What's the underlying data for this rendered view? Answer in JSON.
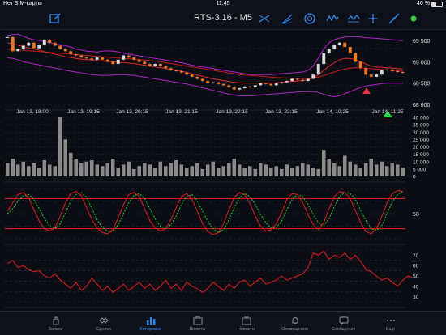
{
  "status_bar": {
    "carrier": "Нет SIM-карты",
    "time": "11:45",
    "battery": "40 %",
    "battery_level": 0.4
  },
  "toolbar": {
    "title": "RTS-3.16 - M5",
    "left_icons": [
      "edit-icon"
    ],
    "right_icons": [
      "line-tool-icon",
      "fan-tool-icon",
      "cycle-tool-icon",
      "elliott-wave-icon",
      "zigzag-icon",
      "crosshair-icon",
      "trend-line-icon",
      "status-dot-icon"
    ],
    "accent_color": "#2c8df0"
  },
  "price_panel": {
    "y_labels": [
      "69 500",
      "69 000",
      "68 500",
      "68 000"
    ],
    "x_labels": [
      "Jan 13, 18:00",
      "Jan 13, 19:15",
      "Jan 13, 20:15",
      "Jan 13, 21:15",
      "Jan 13, 22:15",
      "Jan 13, 23:15",
      "Jan 14, 10:25",
      "Jan 14, 11:25"
    ]
  },
  "volume_panel": {
    "y_labels": [
      "40 000",
      "35 000",
      "30 000",
      "25 000",
      "20 000",
      "15 000",
      "10 000",
      "5 000",
      "0"
    ]
  },
  "oscillator_panel": {
    "y_labels": [
      "50"
    ]
  },
  "rsi_panel": {
    "y_labels": [
      "70",
      "60",
      "50",
      "40",
      "30"
    ]
  },
  "chart_data": {
    "type": "line",
    "price": {
      "ylim": [
        68000,
        69750
      ],
      "close": [
        69580,
        69250,
        69300,
        69380,
        69450,
        69320,
        69400,
        69520,
        69450,
        69380,
        69300,
        69250,
        69180,
        69150,
        69100,
        69080,
        69050,
        69100,
        69050,
        69000,
        68950,
        69050,
        69150,
        69100,
        69050,
        69000,
        68950,
        68900,
        68950,
        68900,
        68850,
        68800,
        68780,
        68750,
        68700,
        68650,
        68600,
        68550,
        68500,
        68520,
        68480,
        68450,
        68400,
        68350,
        68380,
        68420,
        68400,
        68450,
        68500,
        68480,
        68450,
        68500,
        68520,
        68550,
        68600,
        68580,
        68550,
        68600,
        68700,
        68950,
        69200,
        69300,
        69400,
        69450,
        69350,
        69200,
        69000,
        68850,
        68700,
        68650,
        68700,
        68800,
        68820,
        68780,
        68760,
        68750
      ],
      "ema_fast": [
        69450,
        69420,
        69390,
        69360,
        69330,
        69300,
        69270,
        69240,
        69210,
        69180,
        69150,
        69120,
        69100,
        69080,
        69060,
        69050,
        69040,
        69030,
        69020,
        69010,
        69000,
        68990,
        68980,
        68970,
        68960,
        68940,
        68920,
        68900,
        68880,
        68860,
        68840,
        68820,
        68800,
        68780,
        68750,
        68720,
        68690,
        68660,
        68630,
        68600,
        68580,
        68560,
        68540,
        68520,
        68510,
        68500,
        68500,
        68500,
        68500,
        68500,
        68500,
        68510,
        68520,
        68530,
        68540,
        68550,
        68560,
        68580,
        68620,
        68700,
        68800,
        68900,
        68980,
        69050,
        69080,
        69080,
        69050,
        69000,
        68950,
        68900,
        68880,
        68870,
        68860,
        68850,
        68840,
        68830
      ],
      "ema_slow": [
        69300,
        69290,
        69280,
        69270,
        69260,
        69250,
        69240,
        69230,
        69220,
        69210,
        69200,
        69190,
        69180,
        69170,
        69160,
        69150,
        69140,
        69130,
        69120,
        69110,
        69100,
        69090,
        69080,
        69070,
        69060,
        69050,
        69040,
        69030,
        69020,
        69000,
        68980,
        68960,
        68940,
        68920,
        68900,
        68880,
        68860,
        68840,
        68820,
        68800,
        68780,
        68760,
        68740,
        68720,
        68700,
        68690,
        68680,
        68670,
        68660,
        68650,
        68640,
        68630,
        68625,
        68620,
        68615,
        68610,
        68610,
        68610,
        68620,
        68640,
        68680,
        68720,
        68760,
        68800,
        68830,
        68850,
        68860,
        68860,
        68850,
        68840,
        68830,
        68820,
        68810,
        68800,
        68790,
        68780
      ],
      "band_upper": [
        69620,
        69640,
        69650,
        69600,
        69550,
        69520,
        69500,
        69480,
        69450,
        69420,
        69400,
        69380,
        69350,
        69300,
        69280,
        69250,
        69240,
        69230,
        69250,
        69260,
        69250,
        69230,
        69200,
        69180,
        69160,
        69140,
        69120,
        69100,
        69080,
        69060,
        69040,
        69020,
        69000,
        68980,
        68950,
        68920,
        68900,
        68880,
        68860,
        68840,
        68820,
        68800,
        68780,
        68760,
        68740,
        68720,
        68700,
        68700,
        68700,
        68700,
        68700,
        68710,
        68720,
        68730,
        68740,
        68750,
        68760,
        68800,
        68900,
        69100,
        69300,
        69450,
        69520,
        69560,
        69580,
        69590,
        69590,
        69580,
        69570,
        69560,
        69550,
        69540,
        69530,
        69520,
        69510,
        69500
      ],
      "band_lower": [
        69100,
        69080,
        69050,
        69000,
        68980,
        68950,
        68930,
        68900,
        68880,
        68850,
        68830,
        68800,
        68780,
        68760,
        68740,
        68720,
        68700,
        68690,
        68680,
        68680,
        68690,
        68700,
        68700,
        68690,
        68680,
        68660,
        68640,
        68620,
        68600,
        68580,
        68560,
        68540,
        68520,
        68500,
        68480,
        68450,
        68420,
        68390,
        68360,
        68330,
        68300,
        68270,
        68240,
        68220,
        68200,
        68200,
        68200,
        68210,
        68220,
        68230,
        68240,
        68250,
        68260,
        68270,
        68280,
        68290,
        68300,
        68300,
        68300,
        68280,
        68240,
        68200,
        68180,
        68200,
        68250,
        68300,
        68350,
        68400,
        68430,
        68450,
        68470,
        68490,
        68500,
        68500,
        68500,
        68500
      ]
    },
    "volume": {
      "ylim": [
        0,
        40000
      ],
      "values": [
        9000,
        12000,
        8000,
        10000,
        7000,
        9000,
        6000,
        11000,
        8000,
        7000,
        40000,
        25000,
        16000,
        12000,
        9000,
        10000,
        11000,
        8000,
        7000,
        9000,
        12000,
        6000,
        8000,
        10000,
        5000,
        7000,
        9000,
        8000,
        6000,
        10000,
        7000,
        9000,
        11000,
        8000,
        6000,
        7000,
        9000,
        5000,
        8000,
        10000,
        6000,
        7000,
        9000,
        12000,
        8000,
        6000,
        7000,
        5000,
        9000,
        8000,
        6000,
        7000,
        5000,
        8000,
        6000,
        7000,
        9000,
        8000,
        6000,
        5000,
        18000,
        12000,
        9000,
        7000,
        14000,
        10000,
        8000,
        6000,
        9000,
        12000,
        8000,
        10000,
        7000,
        9000,
        8000,
        6000
      ]
    },
    "oscillator": {
      "ylim": [
        0,
        100
      ],
      "levels": [
        80,
        20
      ],
      "k": [
        55,
        72,
        88,
        92,
        82,
        58,
        35,
        20,
        15,
        22,
        45,
        72,
        90,
        94,
        86,
        62,
        38,
        22,
        12,
        10,
        18,
        42,
        68,
        88,
        92,
        84,
        60,
        36,
        22,
        15,
        20,
        38,
        62,
        84,
        90,
        78,
        55,
        30,
        14,
        8,
        12,
        30,
        58,
        82,
        92,
        88,
        70,
        45,
        25,
        15,
        18,
        30,
        52,
        78,
        90,
        88,
        72,
        48,
        28,
        18,
        32,
        60,
        84,
        94,
        92,
        80,
        56,
        32,
        14,
        10,
        20,
        44,
        72,
        90,
        96,
        94
      ],
      "d": [
        50,
        60,
        75,
        85,
        88,
        78,
        60,
        40,
        25,
        20,
        30,
        52,
        75,
        88,
        92,
        82,
        60,
        38,
        22,
        15,
        15,
        28,
        50,
        72,
        86,
        90,
        80,
        60,
        40,
        25,
        20,
        28,
        45,
        68,
        84,
        88,
        75,
        55,
        35,
        20,
        12,
        18,
        38,
        62,
        82,
        90,
        84,
        68,
        48,
        32,
        22,
        22,
        35,
        58,
        78,
        88,
        84,
        68,
        48,
        32,
        26,
        40,
        64,
        84,
        92,
        90,
        78,
        56,
        36,
        20,
        16,
        26,
        50,
        74,
        88,
        94
      ]
    },
    "rsi": {
      "ylim": [
        25,
        75
      ],
      "values": [
        62,
        65,
        58,
        60,
        56,
        54,
        55,
        50,
        48,
        52,
        46,
        42,
        38,
        44,
        36,
        40,
        48,
        42,
        36,
        40,
        34,
        38,
        42,
        36,
        40,
        44,
        38,
        42,
        36,
        40,
        46,
        38,
        42,
        36,
        44,
        40,
        38,
        34,
        38,
        44,
        40,
        36,
        42,
        38,
        44,
        46,
        40,
        44,
        48,
        42,
        44,
        46,
        50,
        46,
        48,
        50,
        52,
        58,
        72,
        70,
        74,
        66,
        70,
        68,
        72,
        66,
        70,
        64,
        56,
        54,
        50,
        46,
        48,
        44,
        40,
        46,
        50,
        48
      ]
    }
  }
}
